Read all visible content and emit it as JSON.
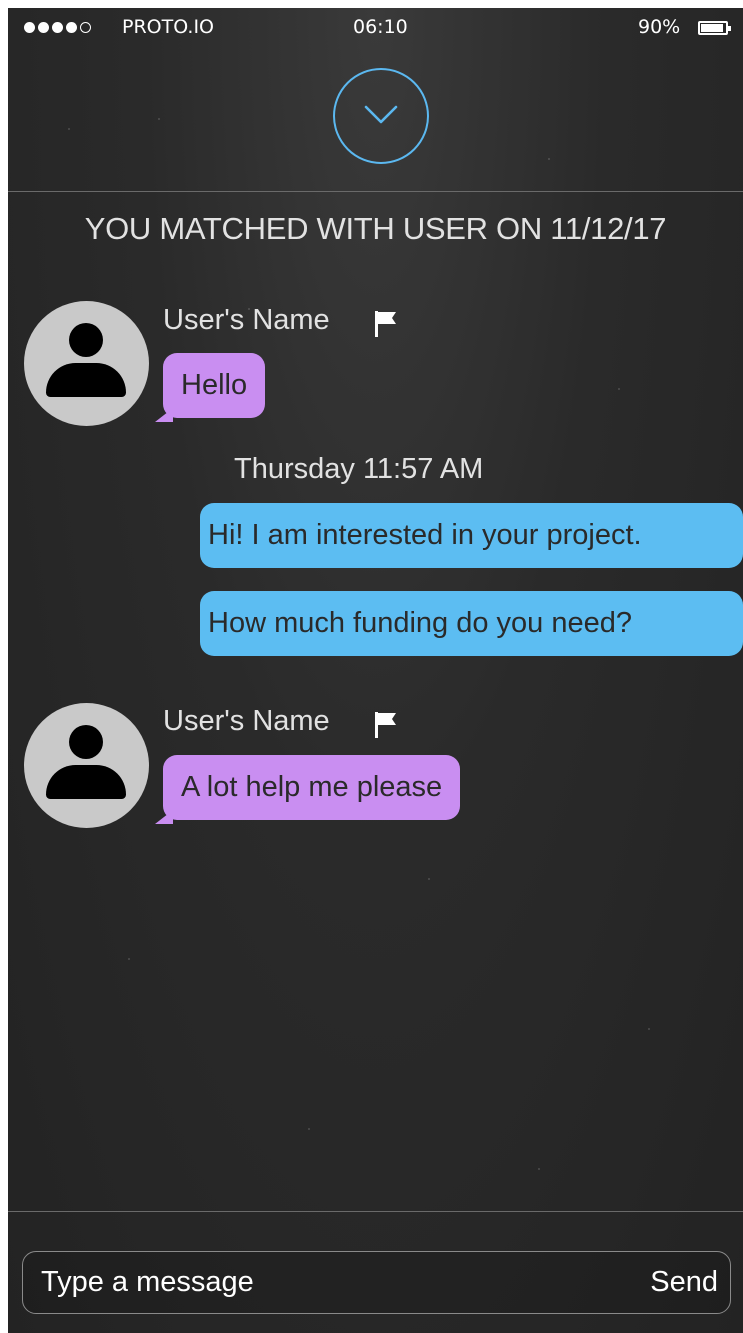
{
  "status_bar": {
    "carrier": "PROTO.IO",
    "time": "06:10",
    "battery": "90%"
  },
  "header": {
    "collapse_icon": "chevron-down-icon"
  },
  "match_banner": "YOU MATCHED WITH USER ON 11/12/17",
  "messages": [
    {
      "sender": "User's Name",
      "text": "Hello"
    },
    {
      "timestamp": "Thursday 11:57 AM"
    },
    {
      "text": "Hi! I am interested in your project."
    },
    {
      "text": "How much funding do you need?"
    },
    {
      "sender": "User's Name",
      "text": "A lot help me please"
    }
  ],
  "composer": {
    "placeholder": "Type a message",
    "value": "",
    "send_label": "Send"
  },
  "colors": {
    "accent": "#5bb8f0",
    "incoming_bubble": "#c98ef1",
    "outgoing_bubble": "#5cbdf2",
    "background": "#2a2a2a"
  }
}
